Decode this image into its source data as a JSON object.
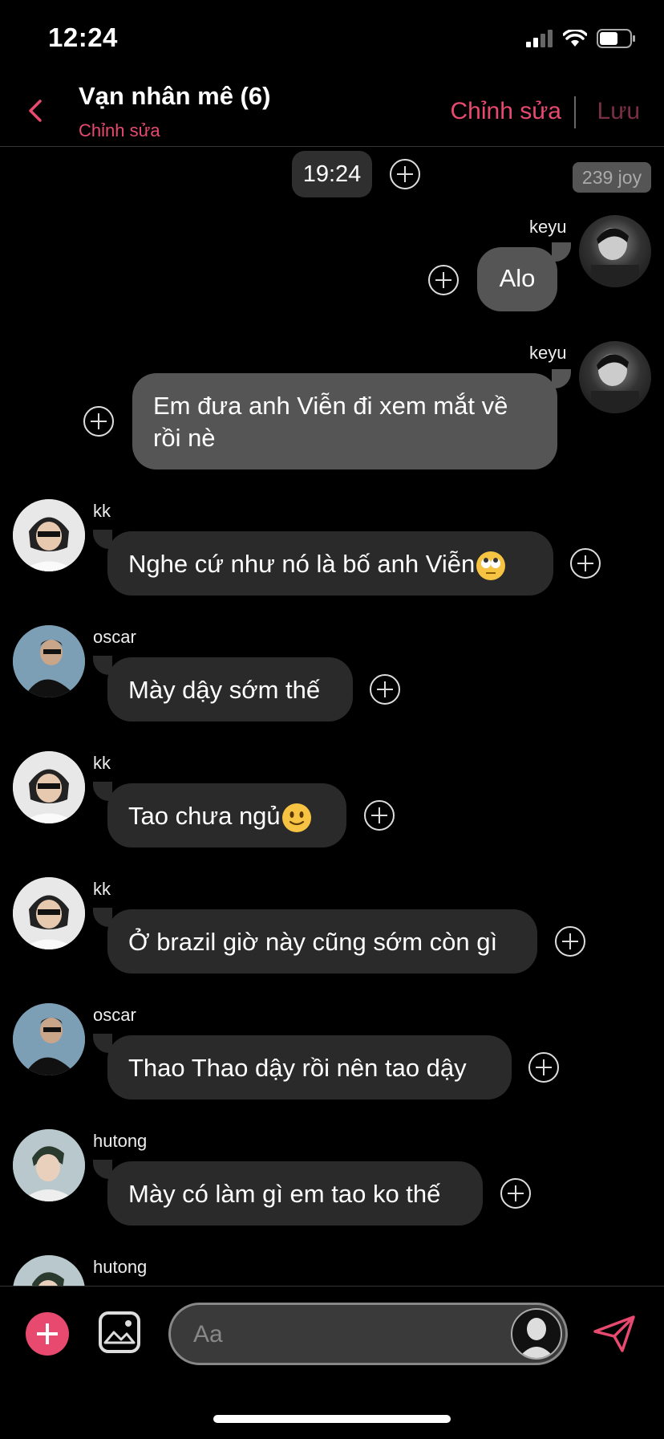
{
  "status_bar": {
    "time": "12:24"
  },
  "header": {
    "title": "Vạn nhân mê (6)",
    "subtitle": "Chỉnh sửa",
    "edit_label": "Chỉnh sửa",
    "save_label": "Lưu"
  },
  "chat": {
    "time_pill": "19:24",
    "joy_badge": "239 joy",
    "messages": [
      {
        "sender": "keyu",
        "text": "Alo",
        "direction": "outgoing"
      },
      {
        "sender": "keyu",
        "text": "Em đưa anh Viễn đi xem mắt về rồi nè",
        "direction": "outgoing"
      },
      {
        "sender": "kk",
        "text": "Nghe cứ như nó là bố anh Viễn",
        "emoji": "eye-roll",
        "direction": "incoming"
      },
      {
        "sender": "oscar",
        "text": "Mày dậy sớm thế",
        "direction": "incoming"
      },
      {
        "sender": "kk",
        "text": "Tao chưa ngủ",
        "emoji": "slight-smile",
        "direction": "incoming"
      },
      {
        "sender": "kk",
        "text": "Ở brazil giờ này cũng sớm còn gì",
        "direction": "incoming"
      },
      {
        "sender": "oscar",
        "text": "Thao Thao dậy rồi nên tao dậy",
        "direction": "incoming"
      },
      {
        "sender": "hutong",
        "text": "Mày có làm gì em tao ko thế",
        "direction": "incoming"
      },
      {
        "sender": "hutong",
        "text": "",
        "direction": "incoming"
      }
    ]
  },
  "composer": {
    "placeholder": "Aa"
  },
  "colors": {
    "accent": "#e84a6f",
    "incoming_bubble": "#2a2a2a",
    "outgoing_bubble": "#555555",
    "background": "#000000"
  }
}
